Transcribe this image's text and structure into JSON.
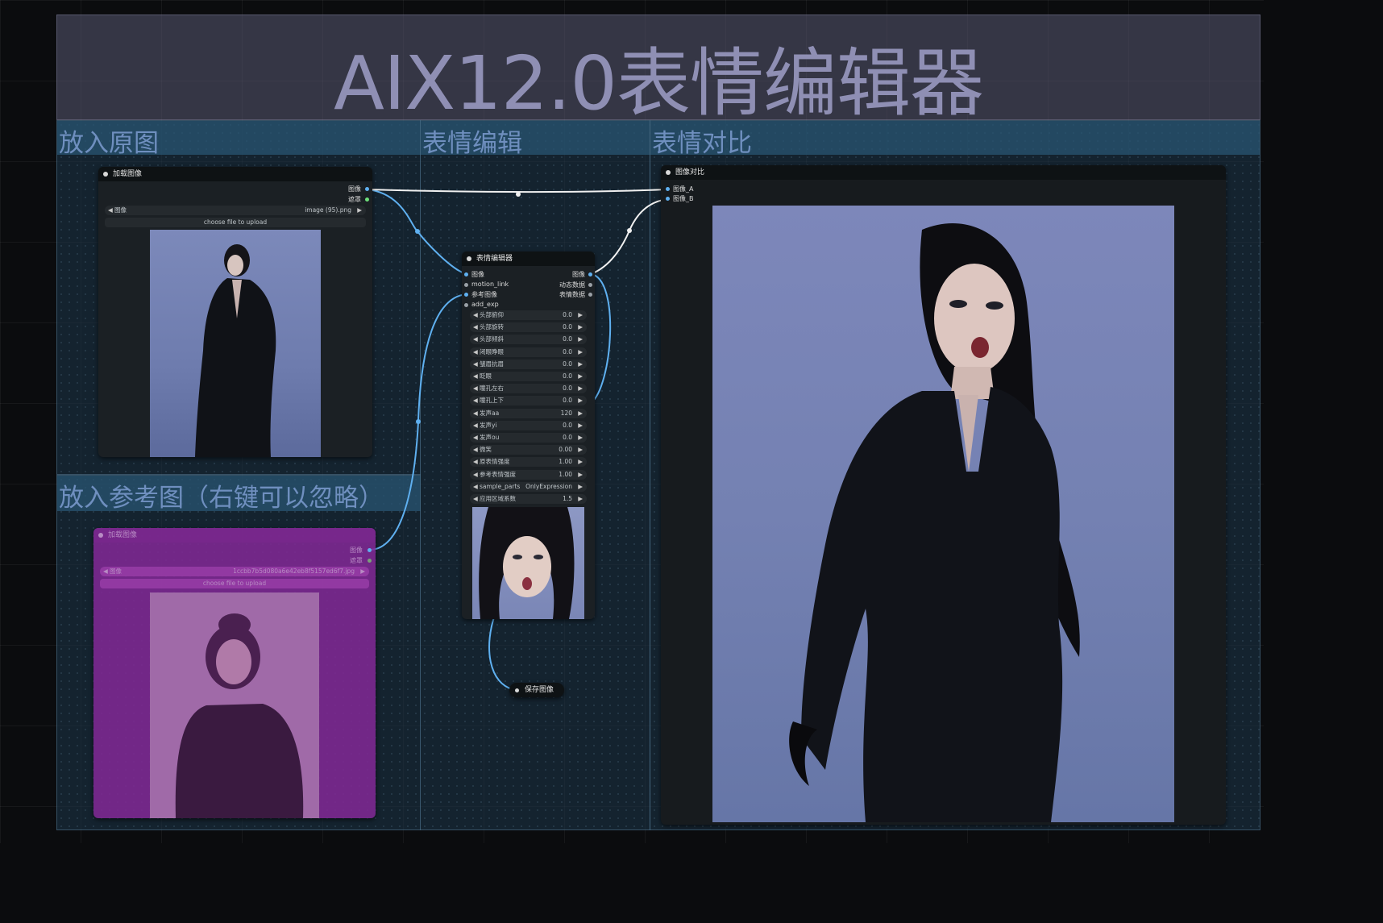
{
  "title_banner": "AIX12.0表情编辑器",
  "groups": {
    "input": "放入原图",
    "edit": "表情编辑",
    "compare": "表情对比",
    "reference": "放入参考图（右键可以忽略）"
  },
  "load_image_node": {
    "title": "加载图像",
    "out_image": "图像",
    "out_mask": "遮罩",
    "widget_label": "图像",
    "widget_value": "image (95).png",
    "upload_label": "choose file to upload"
  },
  "ref_node": {
    "title": "加载图像",
    "out_image": "图像",
    "out_mask": "遮罩",
    "widget_label": "图像",
    "widget_value": "1ccbb7b5d080a6e42eb8f5157ed6f7.jpg",
    "upload_label": "choose file to upload"
  },
  "expression_node": {
    "title": "表情编辑器",
    "inputs": [
      "图像",
      "motion_link",
      "参考图像",
      "add_exp"
    ],
    "outputs": [
      "图像",
      "动态数据",
      "表情数据"
    ],
    "params": [
      {
        "label": "头部俯仰",
        "value": "0.0"
      },
      {
        "label": "头部旋转",
        "value": "0.0"
      },
      {
        "label": "头部倾斜",
        "value": "0.0"
      },
      {
        "label": "闭眼睁眼",
        "value": "0.0"
      },
      {
        "label": "皱眉抗眉",
        "value": "0.0"
      },
      {
        "label": "眨眼",
        "value": "0.0"
      },
      {
        "label": "瞳孔左右",
        "value": "0.0"
      },
      {
        "label": "瞳孔上下",
        "value": "0.0"
      },
      {
        "label": "发声aa",
        "value": "120"
      },
      {
        "label": "发声yi",
        "value": "0.0"
      },
      {
        "label": "发声ou",
        "value": "0.0"
      },
      {
        "label": "微笑",
        "value": "0.00"
      },
      {
        "label": "原表情强度",
        "value": "1.00"
      },
      {
        "label": "参考表情强度",
        "value": "1.00"
      },
      {
        "label": "sample_parts",
        "value": "OnlyExpression"
      },
      {
        "label": "应用区域系数",
        "value": "1.5"
      }
    ]
  },
  "compare_node": {
    "title": "图像对比",
    "inputs": [
      "图像_A",
      "图像_B"
    ]
  },
  "save_node": {
    "title": "保存图像"
  },
  "colors": {
    "link_image": "#5fb0f0",
    "link_white": "#f0f0f0",
    "group_title": "#6f8fbf",
    "bypass_purple": "#8a2f9a",
    "title_band": "#4a4b5e"
  }
}
